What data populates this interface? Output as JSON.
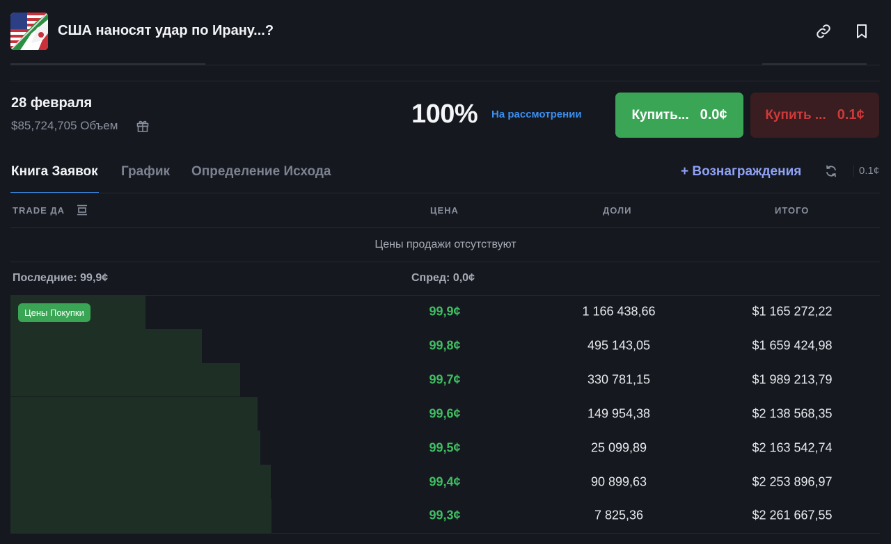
{
  "header": {
    "title": "США наносят удар по Ирану...?"
  },
  "market": {
    "date": "28 февраля",
    "volume": "$85,724,705 Объем",
    "percent": "100%",
    "status": "На рассмотрении",
    "buy_yes_label": "Купить...",
    "buy_yes_price": "0.0¢",
    "buy_no_label": "Купить ...",
    "buy_no_price": "0.1¢"
  },
  "tabs": [
    {
      "label": "Книга Заявок",
      "active": true
    },
    {
      "label": "График",
      "active": false
    },
    {
      "label": "Определение Исхода",
      "active": false
    }
  ],
  "toolbar": {
    "rewards_label": "+ Вознаграждения",
    "tick_size": "0.1¢"
  },
  "orderbook": {
    "col_trade": "TRADE ДА",
    "col_price": "ЦЕНА",
    "col_shares": "ДОЛИ",
    "col_total": "ИТОГО",
    "no_asks": "Цены продажи отсутствуют",
    "last": "Последние: 99,9¢",
    "spread": "Спред: 0,0¢",
    "bids_badge": "Цены Покупки",
    "bids": [
      {
        "price": "99,9¢",
        "shares": "1 166 438,66",
        "total": "$1 165 272,22",
        "depth": 0.517
      },
      {
        "price": "99,8¢",
        "shares": "495 143,05",
        "total": "$1 659 424,98",
        "depth": 0.734
      },
      {
        "price": "99,7¢",
        "shares": "330 781,15",
        "total": "$1 989 213,79",
        "depth": 0.88
      },
      {
        "price": "99,6¢",
        "shares": "149 954,38",
        "total": "$2 138 568,35",
        "depth": 0.946
      },
      {
        "price": "99,5¢",
        "shares": "25 099,89",
        "total": "$2 163 542,74",
        "depth": 0.957
      },
      {
        "price": "99,4¢",
        "shares": "90 899,63",
        "total": "$2 253 896,97",
        "depth": 0.997
      },
      {
        "price": "99,3¢",
        "shares": "7 825,36",
        "total": "$2 261 667,55",
        "depth": 1.0
      }
    ]
  },
  "colors": {
    "background": "#15181f",
    "green": "#3aa655",
    "red": "#cc3a3a",
    "blue": "#3b8ff0",
    "rewards": "#8fa2f6"
  }
}
